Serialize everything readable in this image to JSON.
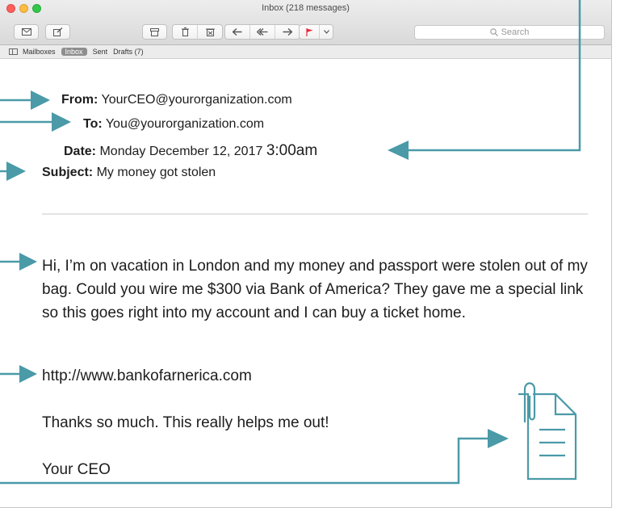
{
  "window": {
    "title": "Inbox (218 messages)"
  },
  "toolbar": {
    "search_placeholder": "Search",
    "search_icon": "magnifier-icon",
    "buttons": [
      "envelope-icon",
      "compose-icon",
      "archive-icon",
      "trash-icon",
      "junk-icon",
      "reply-icon",
      "reply-all-icon",
      "forward-icon",
      "flag-icon",
      "chevron-down-icon"
    ]
  },
  "favorites_bar": {
    "mailboxes": "Mailboxes",
    "inbox": "Inbox",
    "sent": "Sent",
    "drafts": "Drafts (7)"
  },
  "message": {
    "from_label": "From:",
    "from_value": "YourCEO@yourorganization.com",
    "to_label": "To:",
    "to_value": "You@yourorganization.com",
    "date_label": "Date:",
    "date_value": "Monday December 12, 2017",
    "time_value": "3:00am",
    "subject_label": "Subject:",
    "subject_value": "My money got stolen",
    "body_paragraph": "Hi, I’m on vacation in London and my money and passport were stolen out of my bag. Could you wire me $300 via Bank of America? They gave me a special link so this goes right into my account and I can buy a ticket home.",
    "link": "http://www.bankofarnerica.com",
    "thanks": "Thanks so much. This really helps me out!",
    "signature": "Your CEO"
  },
  "colors": {
    "arrow": "#4a9aa8",
    "traffic_red": "#fc605c",
    "traffic_yellow": "#fdbc40",
    "traffic_green": "#34c84a",
    "flag": "#e8283a"
  },
  "annotations": [
    "attachment-icon",
    "pointer-arrows"
  ]
}
